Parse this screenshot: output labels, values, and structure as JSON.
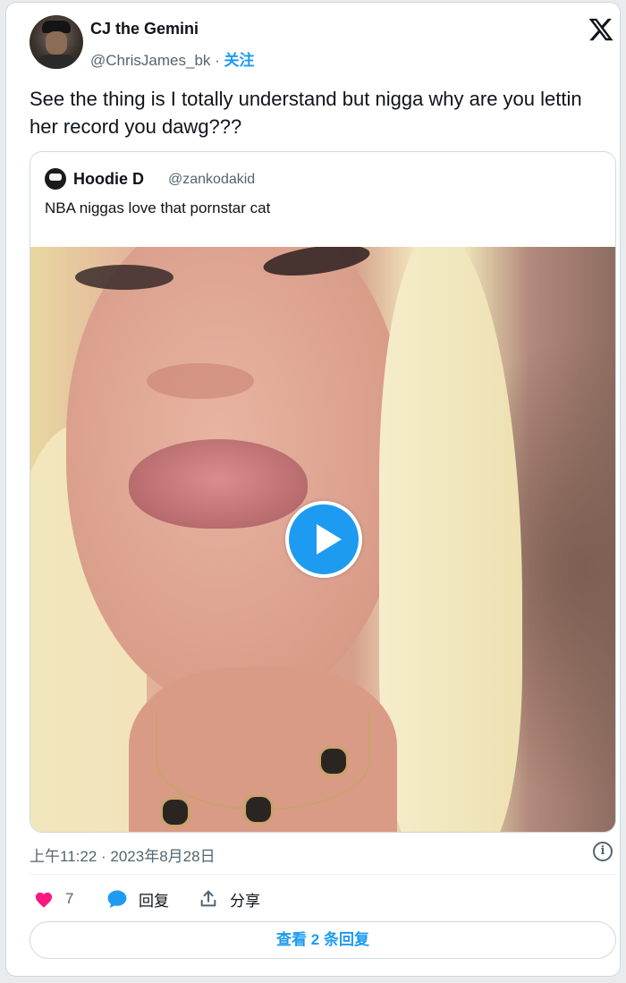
{
  "author": {
    "name": "CJ the Gemini",
    "handle": "@ChrisJames_bk",
    "separator": " · ",
    "follow_label": "关注"
  },
  "brand_icon": "x-logo-icon",
  "tweet": {
    "text": "See the thing is I totally understand but nigga why are you lettin her record you dawg???"
  },
  "quoted_tweet": {
    "name": "Hoodie D",
    "handle": "@zankodakid",
    "text": "NBA niggas love that pornstar cat",
    "media_type": "video",
    "play_icon": "play-icon"
  },
  "meta": {
    "timestamp": "上午11:22 · 2023年8月28日",
    "info_icon": "info-icon"
  },
  "actions": {
    "likes_count": "7",
    "reply_label": "回复",
    "share_label": "分享"
  },
  "more_replies": {
    "label": "查看 2 条回复"
  },
  "colors": {
    "accent": "#1d9bf0",
    "like": "#f91880",
    "text": "#0f1419",
    "secondary_text": "#536471",
    "border": "#cfd9de"
  }
}
